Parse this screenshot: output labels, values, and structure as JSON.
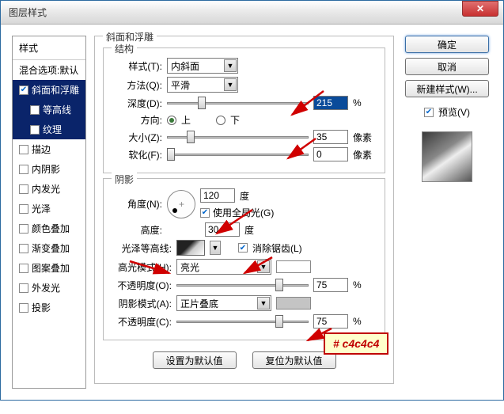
{
  "window": {
    "title": "图层样式"
  },
  "sidebar": {
    "head": "样式",
    "blend": "混合选项:默认",
    "items": [
      {
        "label": "斜面和浮雕",
        "checked": true,
        "selected": true
      },
      {
        "label": "等高线",
        "checked": false,
        "sub": true
      },
      {
        "label": "纹理",
        "checked": false,
        "sub": true
      },
      {
        "label": "描边",
        "checked": false
      },
      {
        "label": "内阴影",
        "checked": false
      },
      {
        "label": "内发光",
        "checked": false
      },
      {
        "label": "光泽",
        "checked": false
      },
      {
        "label": "颜色叠加",
        "checked": false
      },
      {
        "label": "渐变叠加",
        "checked": false
      },
      {
        "label": "图案叠加",
        "checked": false
      },
      {
        "label": "外发光",
        "checked": false
      },
      {
        "label": "投影",
        "checked": false
      }
    ]
  },
  "panel": {
    "title": "斜面和浮雕",
    "structure": {
      "legend": "结构",
      "style_lbl": "样式(T):",
      "style_val": "内斜面",
      "method_lbl": "方法(Q):",
      "method_val": "平滑",
      "depth_lbl": "深度(D):",
      "depth_val": "215",
      "depth_unit": "%",
      "dir_lbl": "方向:",
      "up": "上",
      "down": "下",
      "size_lbl": "大小(Z):",
      "size_val": "35",
      "size_unit": "像素",
      "soft_lbl": "软化(F):",
      "soft_val": "0",
      "soft_unit": "像素"
    },
    "shadow": {
      "legend": "阴影",
      "angle_lbl": "角度(N):",
      "angle_val": "120",
      "angle_unit": "度",
      "global": "使用全局光(G)",
      "alt_lbl": "高度:",
      "alt_val": "30",
      "alt_unit": "度",
      "gloss_lbl": "光泽等高线:",
      "antialias": "消除锯齿(L)",
      "hmode_lbl": "高光模式(H):",
      "hmode_val": "亮光",
      "hopac_lbl": "不透明度(O):",
      "hopac_val": "75",
      "hopac_unit": "%",
      "smode_lbl": "阴影模式(A):",
      "smode_val": "正片叠底",
      "sopac_lbl": "不透明度(C):",
      "sopac_val": "75",
      "sopac_unit": "%"
    },
    "reset_default": "设置为默认值",
    "restore_default": "复位为默认值"
  },
  "right": {
    "ok": "确定",
    "cancel": "取消",
    "newstyle": "新建样式(W)...",
    "preview": "预览(V)"
  },
  "annot": {
    "color_label": "# c4c4c4"
  },
  "colors": {
    "shadow_swatch": "#c4c4c4"
  }
}
